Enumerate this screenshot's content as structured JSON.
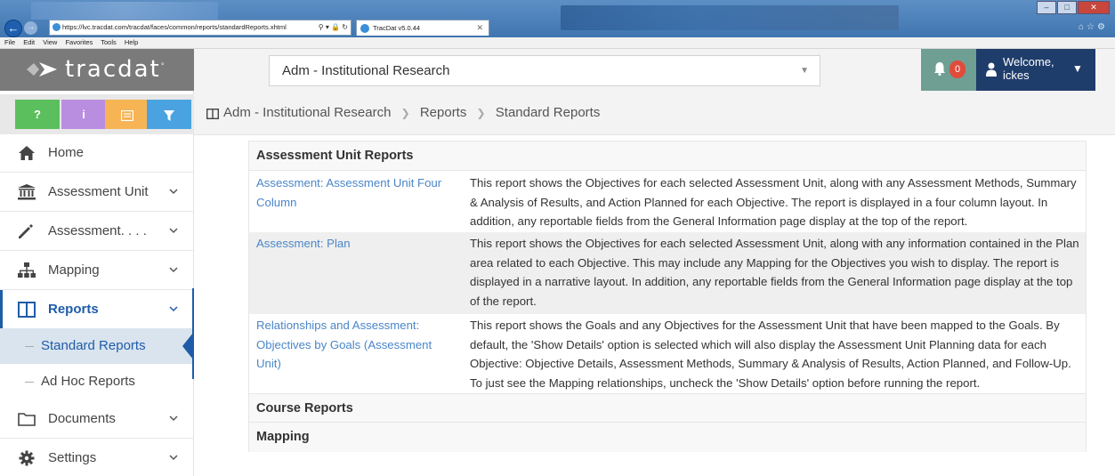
{
  "browser": {
    "url": "https://lvc.tracdat.com/tracdat/faces/common/reports/standardReports.xhtml",
    "tab_title": "TracDat v5.0.44",
    "menu": [
      "File",
      "Edit",
      "View",
      "Favorites",
      "Tools",
      "Help"
    ]
  },
  "header": {
    "logo_text": "tracdat",
    "context_selected": "Adm - Institutional Research",
    "notification_count": "0",
    "welcome_label": "Welcome,",
    "username": "ickes"
  },
  "quick_buttons": [
    {
      "label": "?",
      "color": "#5cbf5e"
    },
    {
      "label": "i",
      "color": "#b98ee0"
    },
    {
      "label": "",
      "icon": "list-icon",
      "color": "#f6b455"
    },
    {
      "label": "",
      "icon": "filter-icon",
      "color": "#4aa3e0"
    }
  ],
  "sidebar": {
    "items": [
      {
        "label": "Home",
        "icon": "home-icon"
      },
      {
        "label": "Assessment Unit",
        "icon": "institution-icon"
      },
      {
        "label": "Assessment. . . .",
        "icon": "pencil-icon"
      },
      {
        "label": "Mapping",
        "icon": "sitemap-icon"
      },
      {
        "label": "Reports",
        "icon": "columns-icon"
      },
      {
        "label": "Documents",
        "icon": "folder-icon"
      },
      {
        "label": "Settings",
        "icon": "gear-icon"
      }
    ],
    "reports_sub": [
      {
        "label": "Standard Reports"
      },
      {
        "label": "Ad Hoc Reports"
      }
    ]
  },
  "breadcrumb": [
    "Adm - Institutional Research",
    "Reports",
    "Standard Reports"
  ],
  "reports": {
    "section_assessment_unit": "Assessment Unit Reports",
    "rows": [
      {
        "link": "Assessment: Assessment Unit Four Column",
        "description": "This report shows the Objectives for each selected Assessment Unit, along with any Assessment Methods, Summary & Analysis of Results, and Action Planned for each Objective. The report is displayed in a four column layout. In addition, any reportable fields from the General Information page display at the top of the report."
      },
      {
        "link": "Assessment: Plan",
        "description": "This report shows the Objectives for each selected Assessment Unit, along with any information contained in the Plan area related to each Objective. This may include any Mapping for the Objectives you wish to display. The report is displayed in a narrative layout. In addition, any reportable fields from the General Information page display at the top of the report."
      },
      {
        "link": "Relationships and Assessment: Objectives by Goals (Assessment Unit)",
        "description": "This report shows the Goals and any Objectives for the Assessment Unit that have been mapped to the Goals. By default, the 'Show Details' option is selected which will also display the Assessment Unit Planning data for each Objective: Objective Details, Assessment Methods, Summary & Analysis of Results, Action Planned, and Follow-Up. To just see the Mapping relationships, uncheck the 'Show Details' option before running the report."
      }
    ],
    "section_course": "Course Reports",
    "section_mapping": "Mapping"
  },
  "colors": {
    "accent": "#1f5ca8",
    "link": "#4a86c8",
    "logo_bg": "#7a7a7a",
    "user_bg": "#1f3d6b",
    "notif_bg": "#6f9f93",
    "badge": "#e04b3a"
  }
}
